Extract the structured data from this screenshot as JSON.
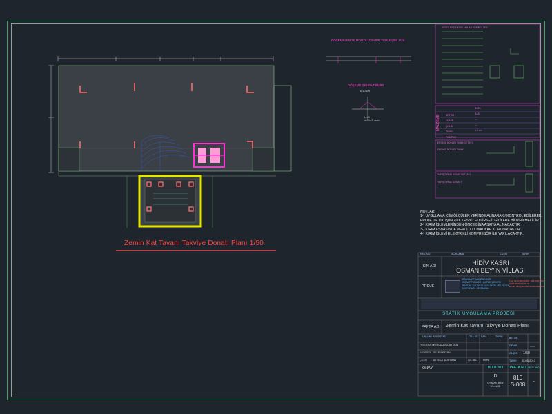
{
  "drawing": {
    "plan_title": "Zemin Kat Tavanı Takviye Donatı Planı  1/50",
    "detail1_title": "DÖŞEMELERDE MONTAJ DEMİRİ YERLEŞİMİ 1/20",
    "detail2_title": "DÖŞEME ŞEHPA DEMİRİ",
    "detail2_sub": "Ø10 cm",
    "detail2_text_a": "L=40",
    "detail2_text_b": "a=Tüz.S.aralık"
  },
  "legend": {
    "header": "KESİTLERDE KULLANILAN SEMBOLLER",
    "side_label": "MALZEME",
    "materials": [
      {
        "k": "BETON",
        "v": "BS25"
      },
      {
        "k": "DEMİR",
        "v": "B420"
      },
      {
        "k": "ÇELİK",
        "v": "—"
      },
      {
        "k": "ZEMİN",
        "v": "—"
      },
      {
        "k": "PAS PAYI",
        "v": "1.5 cm"
      }
    ],
    "box2_title": "EPOKSİ DONATI EKİMİ DETAYI",
    "box3_title": "YAPIŞTIRMA DONATI DETAYI",
    "box2_text": "EPOKSİ DONATI EKİMİ",
    "box3_text": "YAPIŞTIRMA DONATI"
  },
  "notes": {
    "title": "NOTLAR:",
    "lines": [
      "1-) UYGULAMA İÇİN ÖLÇÜLER YERİNDE ALINARAK / KONTROL EDİLEREK,",
      "PROJE İLE UYUŞMAZLIK TESBİT EDİLİRSE İLGİLİLERE BİLDİRİLMELİDİR.",
      "2-) KIRIM İŞLEMLERİNDEN ÖNCE BİNA ASKIYA ALINACAKTIR.",
      "3-) KIRIM ESNASINDA MEVCUT DONATILAR KORUNACAKTIR.",
      "4-) KIRIM İŞLEMİ ELEKTRİKLİ KOMPRESÖR İLE YAPILACAKTIR."
    ]
  },
  "title_block": {
    "rev_header": [
      "REV. NO",
      "AÇIKLAMA",
      "ÇİZEN",
      "TARİH"
    ],
    "isin_adi_label": "İŞİN ADI",
    "isin_adi_line1": "HİDİV KASRI",
    "isin_adi_line2": "OSMAN BEY'İN VİLLASI",
    "proje_label": "PROJE",
    "company_line1": "STANDART MÜHENDİSLİK",
    "company_line2": "İNŞAAT TİCARET LİMİTED ŞİRKETİ",
    "company_line3": "BAĞDAT CADDESİ KAZASKER APT. NO:15",
    "company_line4": "KOZYATAĞI - İSTANBUL",
    "contact_line1": "TEL: 0216 000 00 00 - FAX: 000 00 00",
    "contact_line2": "GSM: 0532 000 00 00",
    "contact_line3": "E-mail: info@standartmuhendislik.com",
    "project_type": "STATİK UYGULAMA PROJESİ",
    "pafta_adi_label": "PAFTA ADI",
    "pafta_adi": "Zemin Kat Tavanı Takviye Donatı Planı",
    "staff_header": [
      "ÜNVAN / ADI SOYADI",
      "ODA SİC.",
      "İMZA",
      "TARİH"
    ],
    "staff": [
      {
        "role": "PROJE MÜH.",
        "name": "FERUDUN GÜLTEKİN"
      },
      {
        "role": "KONTROL",
        "name": "SELEN SAYAN"
      },
      {
        "role": "ÇİZEN",
        "name": "ATTİLLA ŞATIRMAN",
        "oda": "121.5823",
        "tarih": "MON"
      }
    ],
    "side_labels": [
      "BETON",
      "DEMİR",
      "ÖLÇEK",
      "TARİH"
    ],
    "beton_val": "——",
    "demir_val": "——",
    "olcek_val": "1/50",
    "tarih_val": "08.05.2013",
    "onay_label": "ONAY",
    "blok_no_label": "BLOK NO",
    "blok_no": "D",
    "blok_name": "OSMAN BEY VİLLASI",
    "pafta_no_label": "PAFTA NO",
    "pafta_no_1": "810",
    "pafta_no_2": "S-008",
    "rev_no_label": "REV. NO",
    "rev_no": "-"
  },
  "colors": {
    "background": "#1f252c",
    "frame": "#3ea36a",
    "slab": "#3b4047",
    "column": "#ff6a6a",
    "magenta": "#ff2fd6",
    "title_red": "#ff3030",
    "cyan": "#41e0e0",
    "yellow": "#e6e600"
  }
}
